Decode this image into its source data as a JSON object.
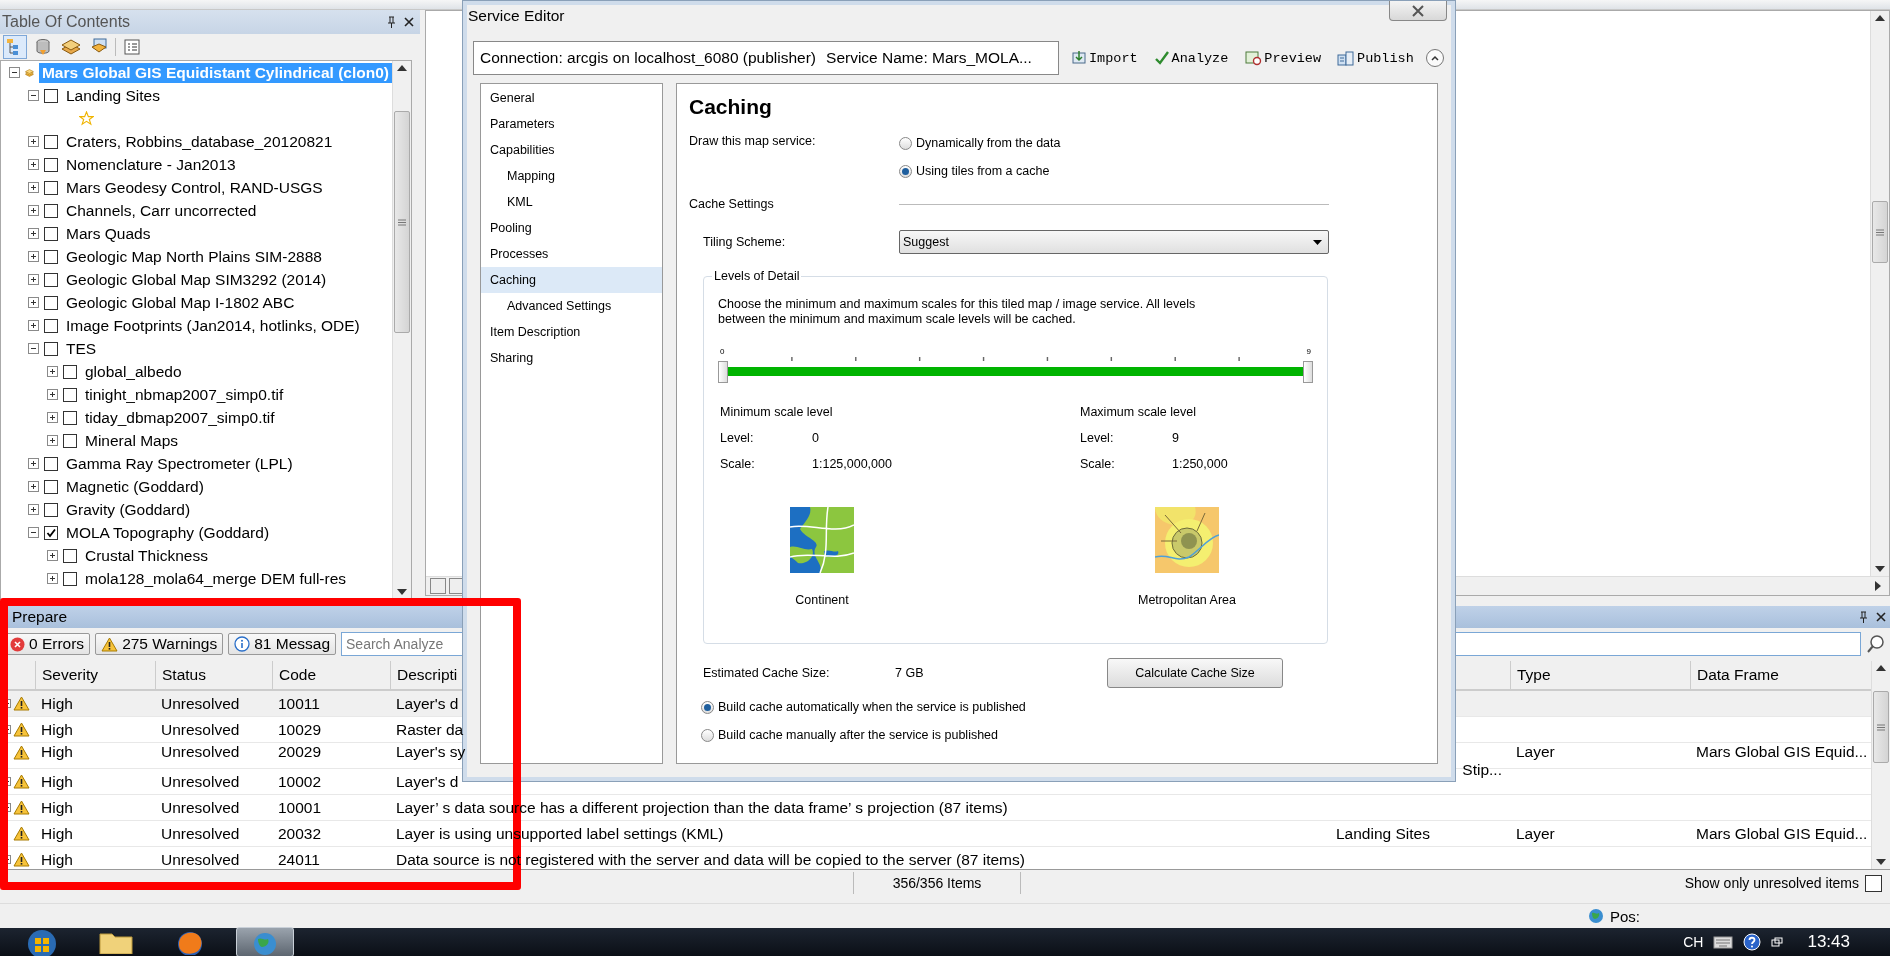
{
  "toc": {
    "title": "Table Of Contents",
    "tree": [
      {
        "label": "Mars Global GIS Equidistant Cylindrical (clon0)",
        "kind": "dataframe",
        "expanded": true,
        "selected": true,
        "children": [
          {
            "label": "Landing Sites",
            "expanded": true,
            "checked": false,
            "selected": false,
            "children": [
              {
                "kind": "symbol"
              }
            ]
          },
          {
            "label": "Craters, Robbins_database_20120821",
            "expanded": false,
            "checked": false,
            "selected": false
          },
          {
            "label": "Nomenclature - Jan2013",
            "expanded": false,
            "checked": false,
            "selected": false
          },
          {
            "label": "Mars Geodesy Control, RAND-USGS",
            "expanded": false,
            "checked": false,
            "selected": false
          },
          {
            "label": "Channels, Carr uncorrected",
            "expanded": false,
            "checked": false,
            "selected": false
          },
          {
            "label": "Mars Quads",
            "expanded": false,
            "checked": false,
            "selected": false
          },
          {
            "label": "Geologic Map North Plains SIM-2888",
            "expanded": false,
            "checked": false,
            "selected": false
          },
          {
            "label": "Geologic Global Map SIM3292 (2014)",
            "expanded": false,
            "checked": false,
            "selected": false
          },
          {
            "label": "Geologic Global Map I-1802 ABC",
            "expanded": false,
            "checked": false,
            "selected": false
          },
          {
            "label": "Image Footprints (Jan2014, hotlinks, ODE)",
            "expanded": false,
            "checked": false,
            "selected": false
          },
          {
            "label": "TES",
            "expanded": true,
            "checked": false,
            "selected": false,
            "children": [
              {
                "label": "global_albedo",
                "expanded": false,
                "checked": false,
                "selected": false
              },
              {
                "label": "tinight_nbmap2007_simp0.tif",
                "expanded": false,
                "checked": false,
                "selected": false
              },
              {
                "label": "tiday_dbmap2007_simp0.tif",
                "expanded": false,
                "checked": false,
                "selected": false
              },
              {
                "label": "Mineral Maps",
                "expanded": false,
                "checked": false,
                "selected": false
              }
            ]
          },
          {
            "label": "Gamma Ray Spectrometer (LPL)",
            "expanded": false,
            "checked": false,
            "selected": false
          },
          {
            "label": "Magnetic (Goddard)",
            "expanded": false,
            "checked": false,
            "selected": false
          },
          {
            "label": "Gravity (Goddard)",
            "expanded": false,
            "checked": false,
            "selected": false
          },
          {
            "label": "MOLA Topography (Goddard)",
            "expanded": true,
            "checked": true,
            "selected": false,
            "children": [
              {
                "label": "Crustal Thickness",
                "expanded": false,
                "checked": false,
                "selected": false
              },
              {
                "label": "mola128_mola64_merge DEM full-res",
                "expanded": false,
                "checked": false,
                "selected": false
              }
            ]
          }
        ]
      }
    ]
  },
  "editor": {
    "title": "Service Editor",
    "connection": "Connection: arcgis on localhost_6080 (publisher)",
    "service_name": "Service Name: Mars_MOLA...",
    "toolbar": [
      {
        "label": "Import",
        "kind": "import"
      },
      {
        "label": "Analyze",
        "kind": "analyze"
      },
      {
        "label": "Preview",
        "kind": "preview"
      },
      {
        "label": "Publish",
        "kind": "publish"
      }
    ],
    "nav": [
      {
        "label": "General",
        "selected": false
      },
      {
        "label": "Parameters",
        "selected": false
      },
      {
        "label": "Capabilities",
        "selected": false,
        "children": [
          {
            "label": "Mapping",
            "selected": false
          },
          {
            "label": "KML",
            "selected": false
          }
        ]
      },
      {
        "label": "Pooling",
        "selected": false
      },
      {
        "label": "Processes",
        "selected": false
      },
      {
        "label": "Caching",
        "selected": true,
        "children": [
          {
            "label": "Advanced Settings",
            "selected": false
          }
        ]
      },
      {
        "label": "Item Description",
        "selected": false
      },
      {
        "label": "Sharing",
        "selected": false
      }
    ],
    "caching": {
      "heading": "Caching",
      "draw_label": "Draw this map service:",
      "draw_options": [
        {
          "label": "Dynamically from the data",
          "selected": false
        },
        {
          "label": "Using tiles from a cache",
          "selected": true
        }
      ],
      "cache_settings": "Cache Settings",
      "tiling_label": "Tiling Scheme:",
      "tiling_value": "Suggest",
      "lod": {
        "title": "Levels of Detail",
        "description": "Choose the minimum and maximum scales for this tiled map / image service. All levels between the minimum and maximum scale levels will be cached.",
        "slider": {
          "start_label": "0",
          "end_label": "9",
          "level": 1
        },
        "scales": [
          {
            "title": "Minimum scale level",
            "level_label": "Level:",
            "level_value": "0",
            "scale_label": "Scale:",
            "scale_value": "1:125,000,000"
          },
          {
            "title": "Maximum scale level",
            "level_label": "Level:",
            "level_value": "9",
            "scale_label": "Scale:",
            "scale_value": "1:250,000"
          }
        ],
        "previews": [
          {
            "kind": "continent",
            "caption": "Continent"
          },
          {
            "kind": "metro",
            "caption": "Metropolitan Area"
          }
        ]
      },
      "estimate_label": "Estimated Cache Size:",
      "estimate_value": "7 GB",
      "calc_button": "Calculate Cache Size",
      "build_options": [
        {
          "label": "Build cache automatically when the service is published",
          "selected": true
        },
        {
          "label": "Build cache manually after the service is published",
          "selected": false
        }
      ]
    }
  },
  "prepare": {
    "title": "Prepare",
    "filters": [
      {
        "label": "0 Errors",
        "kind": "error"
      },
      {
        "label": "275 Warnings",
        "kind": "warning"
      },
      {
        "label": "81 Messag",
        "kind": "info"
      }
    ],
    "search": {
      "placeholder": "Search Analyze"
    },
    "columns": [
      {
        "label": "Severity",
        "kind": "severity"
      },
      {
        "label": "Status",
        "kind": "status"
      },
      {
        "label": "Code",
        "kind": "code"
      },
      {
        "label": "Descripti",
        "kind": "description"
      },
      {
        "label": "Type",
        "kind": "type"
      },
      {
        "label": "Data Frame",
        "kind": "data_frame"
      }
    ],
    "rows": [
      {
        "expandable": true,
        "selected": true,
        "severity": "High",
        "status": "Unresolved",
        "code": "10011",
        "description": "Layer's d"
      },
      {
        "expandable": true,
        "selected": false,
        "severity": "High",
        "status": "Unresolved",
        "code": "10029",
        "description": "Raster da"
      },
      {
        "expandable": false,
        "selected": false,
        "severity": "High",
        "status": "Unresolved",
        "code": "20029",
        "description": "Layer's sy",
        "name_tail": "Stip...",
        "type": "Layer",
        "data_frame": "Mars Global GIS Equid..."
      },
      {
        "expandable": true,
        "selected": false,
        "severity": "High",
        "status": "Unresolved",
        "code": "10002",
        "description": "Layer's d"
      },
      {
        "expandable": true,
        "selected": false,
        "severity": "High",
        "status": "Unresolved",
        "code": "10001",
        "description": "Layer’ s data source has a different projection than the data frame’ s projection (87 items)"
      },
      {
        "expandable": false,
        "selected": false,
        "severity": "High",
        "status": "Unresolved",
        "code": "20032",
        "description": "Layer is using unsupported label settings (KML)",
        "name": "Landing Sites",
        "type": "Layer",
        "data_frame": "Mars Global GIS Equid..."
      },
      {
        "expandable": true,
        "selected": false,
        "severity": "High",
        "status": "Unresolved",
        "code": "24011",
        "description": "Data source is not registered with the server and data will be copied to the server (87 items)"
      }
    ],
    "item_count": "356/356 Items",
    "unresolved_only": {
      "label": "Show only unresolved items",
      "checked": false
    }
  },
  "status_bar": {
    "pos": "Pos:"
  },
  "taskbar": {
    "apps": [
      {
        "kind": "start",
        "selected": false
      },
      {
        "kind": "folder",
        "selected": false
      },
      {
        "kind": "browser",
        "selected": false
      },
      {
        "kind": "globe",
        "selected": true
      }
    ],
    "language": "CH",
    "clock": "13:43"
  }
}
